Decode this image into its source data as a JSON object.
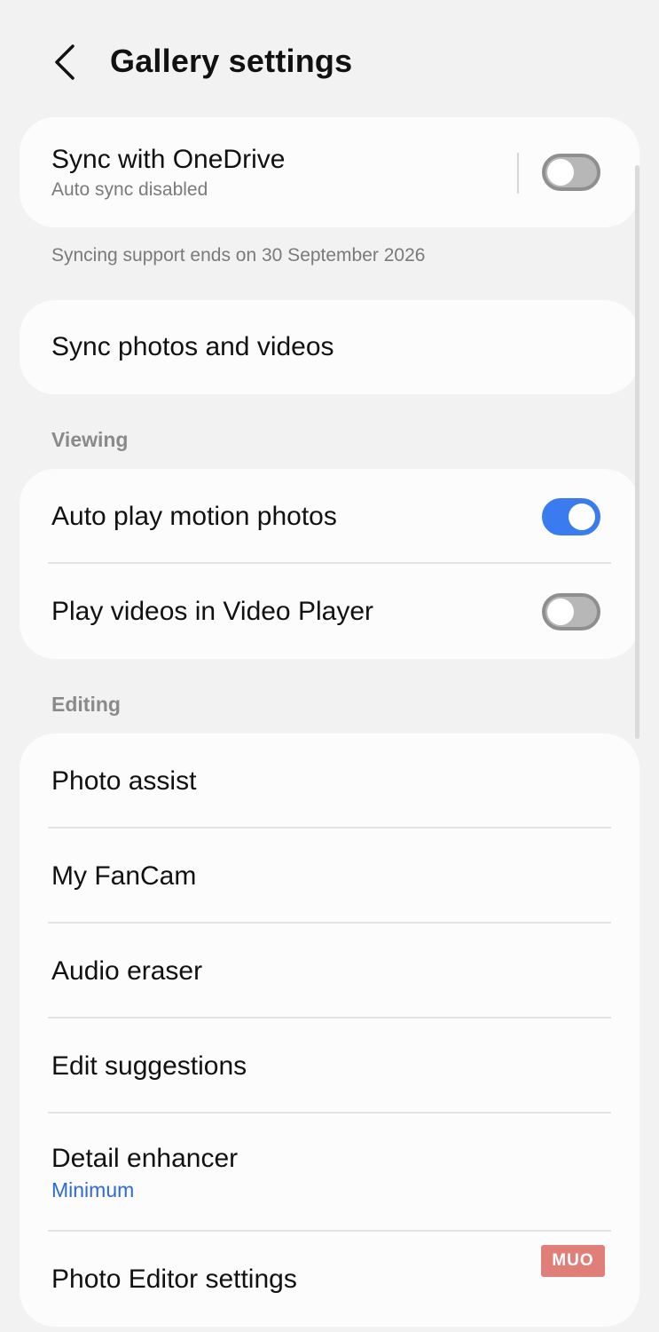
{
  "header": {
    "title": "Gallery settings",
    "back_icon": "chevron-left-icon"
  },
  "sync_card": {
    "title": "Sync with OneDrive",
    "subtitle": "Auto sync disabled",
    "toggle_state": "off"
  },
  "sync_footnote": "Syncing support ends on 30 September 2026",
  "sync_media": {
    "title": "Sync photos and videos"
  },
  "viewing": {
    "label": "Viewing",
    "items": [
      {
        "title": "Auto play motion photos",
        "toggle_state": "on"
      },
      {
        "title": "Play videos in Video Player",
        "toggle_state": "off"
      }
    ]
  },
  "editing": {
    "label": "Editing",
    "items": [
      {
        "title": "Photo assist"
      },
      {
        "title": "My FanCam"
      },
      {
        "title": "Audio eraser"
      },
      {
        "title": "Edit suggestions"
      },
      {
        "title": "Detail enhancer",
        "subtitle": "Minimum"
      },
      {
        "title": "Photo Editor settings"
      }
    ]
  },
  "watermark": {
    "text": "MUO"
  },
  "colors": {
    "background": "#f2f2f2",
    "card": "#fcfcfc",
    "toggle_on": "#3a7bf0",
    "toggle_off": "#b7b7b7",
    "accent_text": "#2f6ad0"
  }
}
